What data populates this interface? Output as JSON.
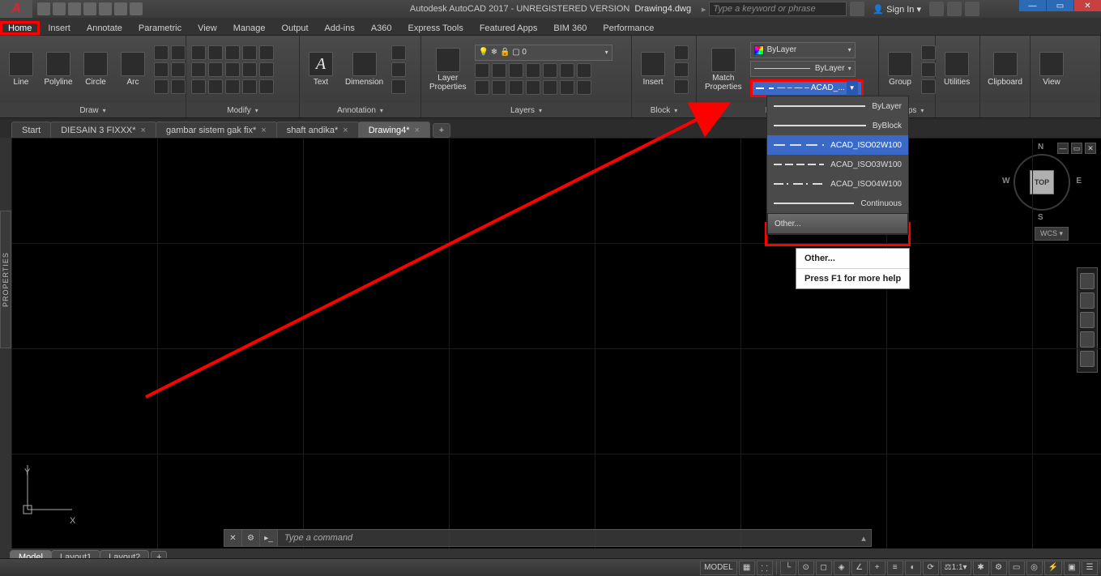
{
  "app": {
    "title": "Autodesk AutoCAD 2017 - UNREGISTERED VERSION",
    "filename": "Drawing4.dwg",
    "search_placeholder": "Type a keyword or phrase",
    "signin": "Sign In"
  },
  "ribbon_tabs": [
    "Home",
    "Insert",
    "Annotate",
    "Parametric",
    "View",
    "Manage",
    "Output",
    "Add-ins",
    "A360",
    "Express Tools",
    "Featured Apps",
    "BIM 360",
    "Performance"
  ],
  "ribbon_active": "Home",
  "panels": {
    "draw": {
      "title": "Draw",
      "items": [
        "Line",
        "Polyline",
        "Circle",
        "Arc"
      ]
    },
    "modify": {
      "title": "Modify"
    },
    "annotation": {
      "title": "Annotation",
      "items": [
        "Text",
        "Dimension"
      ]
    },
    "layers": {
      "title": "Layers",
      "item": "Layer\nProperties"
    },
    "block": {
      "title": "Block",
      "item": "Insert"
    },
    "properties": {
      "title": "Properties",
      "match": "Match\nProperties",
      "color": "ByLayer",
      "lweight": "ByLayer",
      "ltype": "— – — – ACAD_..."
    },
    "groups": {
      "title": "Groups",
      "item": "Group"
    },
    "utilities": {
      "title": "Utilities"
    },
    "clipboard": {
      "title": "Clipboard"
    },
    "view": {
      "title": "View"
    }
  },
  "doc_tabs": [
    {
      "label": "Start",
      "active": false,
      "closable": false
    },
    {
      "label": "DIESAIN 3 FIXXX*",
      "active": false,
      "closable": true
    },
    {
      "label": "gambar sistem gak fix*",
      "active": false,
      "closable": true
    },
    {
      "label": "shaft andika*",
      "active": false,
      "closable": true
    },
    {
      "label": "Drawing4*",
      "active": true,
      "closable": true
    }
  ],
  "linetype_dropdown": {
    "items": [
      {
        "label": "ByLayer",
        "style": "cont"
      },
      {
        "label": "ByBlock",
        "style": "cont"
      },
      {
        "label": "ACAD_ISO02W100",
        "style": "d1",
        "selected": true
      },
      {
        "label": "ACAD_ISO03W100",
        "style": "d2"
      },
      {
        "label": "ACAD_ISO04W100",
        "style": "d3"
      },
      {
        "label": "Continuous",
        "style": "cont"
      }
    ],
    "other": "Other..."
  },
  "tooltip": {
    "title": "Other...",
    "help": "Press F1 for more help"
  },
  "viewcube": {
    "face": "TOP",
    "n": "N",
    "s": "S",
    "e": "E",
    "w": "W",
    "wcs": "WCS"
  },
  "ucs": {
    "x": "X",
    "y": "Y"
  },
  "cmdline": {
    "prompt": "Type a command"
  },
  "layout_tabs": [
    "Model",
    "Layout1",
    "Layout2"
  ],
  "status": {
    "model": "MODEL",
    "scale": "1:1"
  },
  "side_tab": "PROPERTIES"
}
